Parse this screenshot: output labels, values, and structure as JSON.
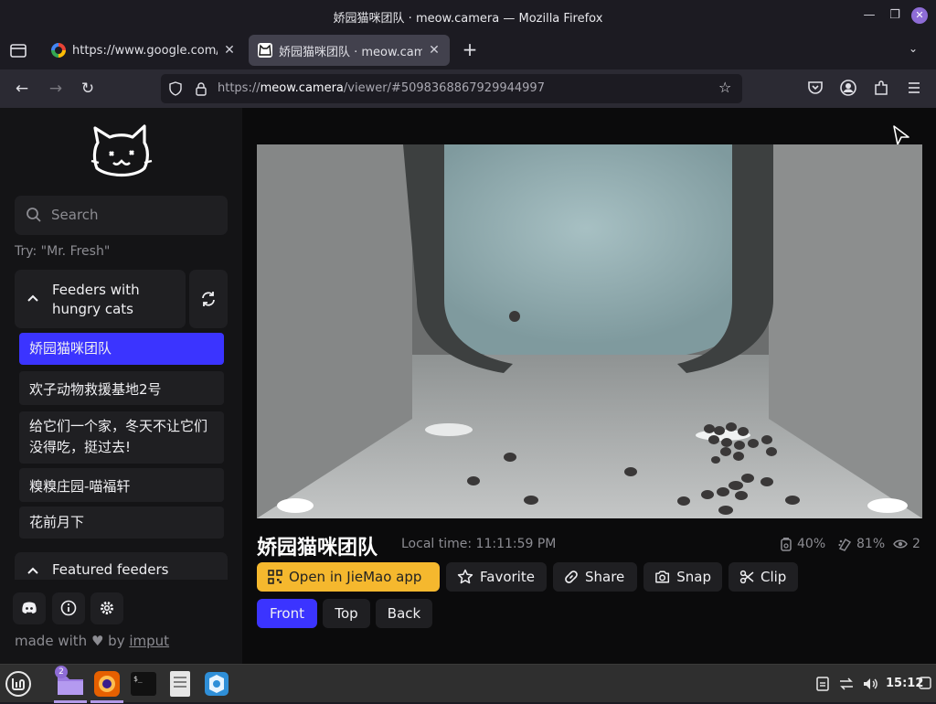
{
  "window": {
    "title": "娇园猫咪团队 · meow.camera — Mozilla Firefox"
  },
  "tabs": [
    {
      "title": "https://www.google.com/se",
      "favicon": "google-icon"
    },
    {
      "title": "娇园猫咪团队 · meow.came",
      "favicon": "meow-camera-icon",
      "active": true
    }
  ],
  "urlbar": {
    "scheme": "https://",
    "host": "meow.camera",
    "path": "/viewer/#5098368867929944997"
  },
  "sidebar": {
    "search": {
      "placeholder": "Search"
    },
    "hint": "Try: \"Mr. Fresh\"",
    "group_hungry": "Feeders with hungry cats",
    "feeders": [
      "娇园猫咪团队",
      "欢子动物救援基地2号",
      "给它们一个家，冬天不让它们没得吃，挺过去!",
      "糗糗庄园-喵福轩",
      "花前月下"
    ],
    "group_featured": "Featured feeders",
    "footer": {
      "made_with": "made with",
      "by": "by",
      "author": "imput"
    }
  },
  "camera": {
    "title": "娇园猫咪团队",
    "local_time": "Local time: 11:11:59 PM",
    "food_level": "40%",
    "battery_level": "81%",
    "viewers": "2"
  },
  "actions": {
    "open_app": "Open in JieMao app",
    "favorite": "Favorite",
    "share": "Share",
    "snap": "Snap",
    "clip": "Clip"
  },
  "views": {
    "front": "Front",
    "top": "Top",
    "back": "Back",
    "selected": "Front"
  },
  "taskbar": {
    "clock": "15:12",
    "files_badge": "2"
  },
  "colors": {
    "accent": "#3b34ff",
    "open_app": "#f5b82e"
  }
}
